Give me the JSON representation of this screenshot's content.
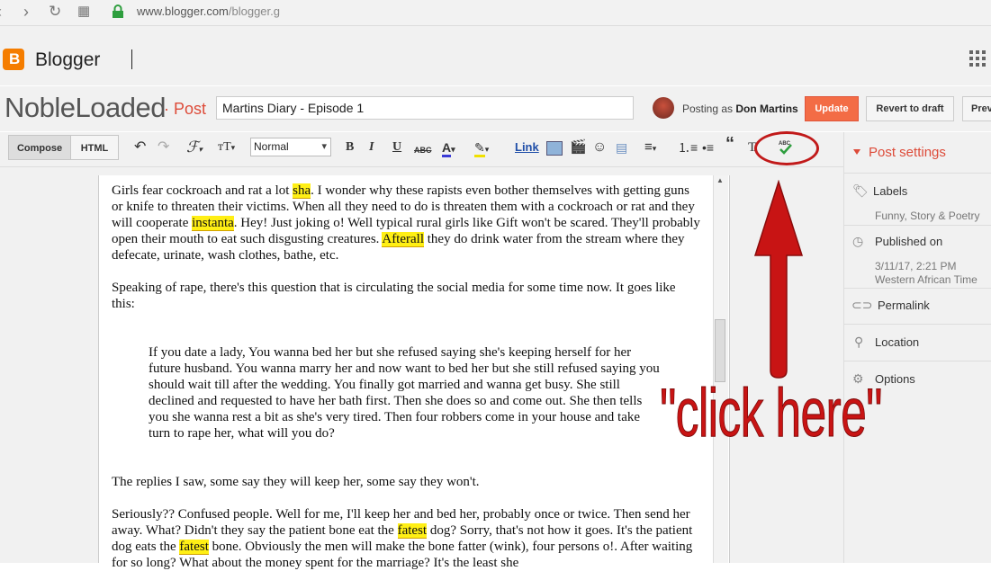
{
  "browser": {
    "url_host": "www.blogger.com",
    "url_path": "/blogger.g"
  },
  "app": {
    "brand": "Blogger"
  },
  "post_header": {
    "blog_name": "NobleLoaded",
    "post_label": "· Post",
    "title_value": "Martins Diary - Episode 1",
    "posting_as_prefix": "Posting as",
    "posting_as_user": "Don Martins",
    "update_label": "Update",
    "revert_label": "Revert to draft",
    "preview_label": "Prev"
  },
  "toolbar": {
    "compose_label": "Compose",
    "html_label": "HTML",
    "format_value": "Normal",
    "link_label": "Link",
    "bold_label": "B",
    "italic_label": "I",
    "underline_label": "U",
    "strike_label": "ABC"
  },
  "editor": {
    "p1_a": "Girls fear cockroach and rat a lot ",
    "p1_h1": "sha",
    "p1_b": ". I wonder why these rapists even bother themselves with getting guns or knife to threaten their victims. When all they need to do is threaten them with a cockroach or rat and they will cooperate ",
    "p1_h2": "instanta",
    "p1_c": ". Hey! Just joking o! Well typical rural girls like Gift won't be scared. They'll probably open their mouth to eat such disgusting creatures. ",
    "p1_h3": "Afterall",
    "p1_d": " they do drink water from the stream where they defecate, urinate, wash clothes, bathe, etc.",
    "p2": "Speaking of rape, there's this question that is circulating the social media for some time now. It goes like this:",
    "p3": " If you date a lady, You wanna bed her but she refused saying she's keeping herself for her future husband. You wanna marry her and now want to bed her but she still refused saying you should wait till after the wedding. You finally got married and wanna get busy. She still declined and requested to have her bath first. Then she does so and come out. She then tells you she wanna rest a bit as she's very tired. Then four robbers come in your house and take turn to rape her, what will you do?",
    "p4": " The replies I saw, some say they will keep her, some say they won't.",
    "p5_a": "Seriously?? Confused people. Well for me, I'll keep her and bed her, probably once or twice. Then send her away. What? Didn't they say the patient bone eat the ",
    "p5_h1": "fatest",
    "p5_b": " dog? Sorry, that's not how it goes. It's the patient dog eats the ",
    "p5_h2": "fatest",
    "p5_c": " bone. Obviously the men will make the bone fatter (wink), four persons o!. After waiting for so long? What about the money spent for the marriage? It's the least she"
  },
  "sidebar": {
    "title": "Post settings",
    "labels_h": "Labels",
    "labels_v": "Funny, Story & Poetry",
    "published_h": "Published on",
    "published_date": "3/11/17, 2:21 PM",
    "published_tz": "Western African Time",
    "permalink_h": "Permalink",
    "location_h": "Location",
    "options_h": "Options"
  },
  "annotation": {
    "text": "\"click here\""
  },
  "colors": {
    "accent": "#dd4b39",
    "update_button": "#f36c45",
    "annotation_red": "#c81414",
    "highlight": "#ffef15"
  }
}
